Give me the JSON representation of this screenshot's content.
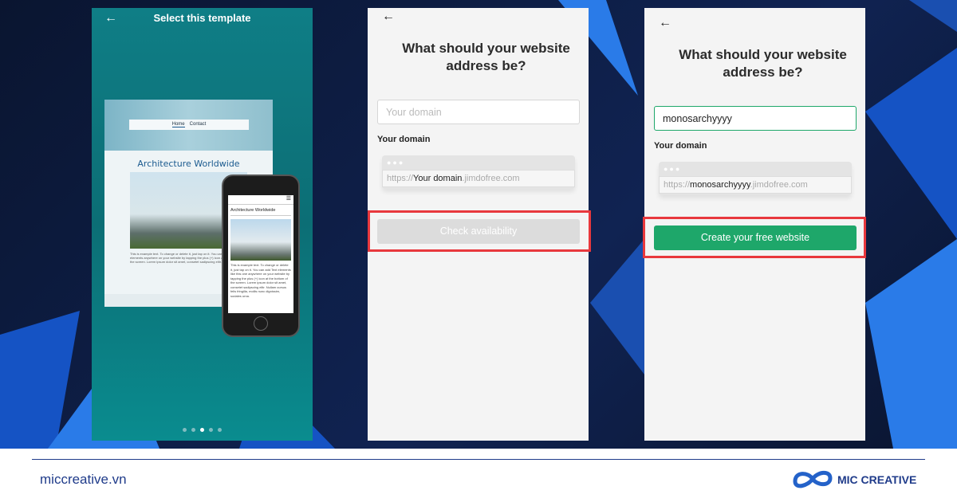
{
  "panel1": {
    "back_icon": "arrow-left",
    "title": "Select this template",
    "template": {
      "nav": [
        "Home",
        "Contact"
      ],
      "heading": "Architecture Worldwide",
      "body": "This is example text. To change or delete it, just tap on it. You can add Text elements anywhere on your website by tapping the plus (+) icon at the bottom of the screen. Lorem ipsum dolor sit amet, consetet sadipscing elitr.",
      "phone_heading": "Architecture Worldwide",
      "phone_body": "This is example text. To change or delete it, just tap on it. You can add Text elements like this one anywhere on your website by tapping the plus (+) icon at the bottom of the screen. Lorem ipsum dolor sit amet, consetet sadipscing elitr. Nullam cursus felis fringilla, mollis nunc dignissim, sodales urna."
    },
    "pages": 5,
    "active_page": 3
  },
  "panel2": {
    "back_icon": "arrow-left",
    "question": "What should your website address be?",
    "input_placeholder": "Your domain",
    "label": "Your domain",
    "url_prefix": "https://",
    "url_domain": "Your domain",
    "url_suffix": ".jimdofree.com",
    "button": "Check availability"
  },
  "panel3": {
    "back_icon": "arrow-left",
    "question": "What should your website address be?",
    "input_value": "monosarchyyyy",
    "label": "Your domain",
    "url_prefix": "https://",
    "url_domain": "monosarchyyyy",
    "url_suffix": ".jimdofree.com",
    "button": "Create your free website"
  },
  "footer": {
    "site": "miccreative.vn",
    "brand": "MIC CREATIVE"
  },
  "colors": {
    "highlight": "#e8383d",
    "primary_button": "#1ea76a",
    "teal": "#0f7e86",
    "brand": "#1f3b8a"
  }
}
